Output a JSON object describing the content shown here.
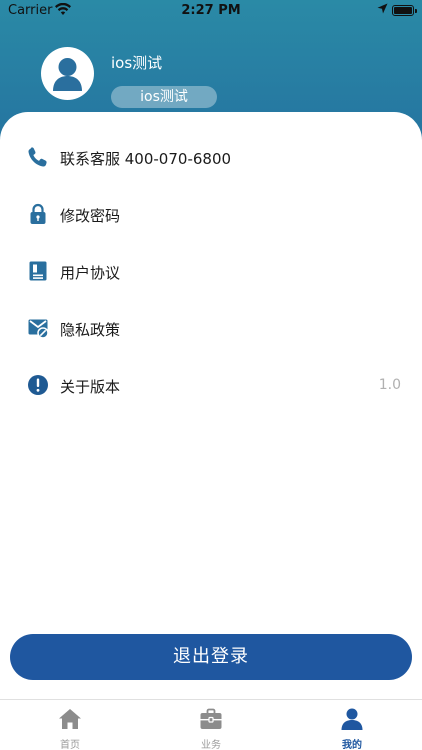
{
  "status_bar": {
    "carrier": "Carrier",
    "time": "2:27 PM",
    "battery_level": 1.0
  },
  "profile": {
    "name": "ios测试",
    "tag": "ios测试"
  },
  "menu": [
    {
      "label": "联系客服 400-070-6800",
      "icon": "phone-icon",
      "value": ""
    },
    {
      "label": "修改密码",
      "icon": "lock-icon",
      "value": ""
    },
    {
      "label": "用户协议",
      "icon": "document-icon",
      "value": ""
    },
    {
      "label": "隐私政策",
      "icon": "privacy-icon",
      "value": ""
    },
    {
      "label": "关于版本",
      "icon": "info-icon",
      "value": "1.0"
    }
  ],
  "logout_label": "退出登录",
  "tabs": [
    {
      "label": "首页",
      "icon": "home-icon",
      "active": false
    },
    {
      "label": "业务",
      "icon": "briefcase-icon",
      "active": false
    },
    {
      "label": "我的",
      "icon": "person-icon",
      "active": true
    }
  ],
  "colors": {
    "header_gradient_top": "#2a8aa6",
    "header_gradient_bottom": "#2573a0",
    "accent": "#1f57a0",
    "icon_blue": "#2a6f9e",
    "inactive_gray": "#8c8c8c"
  }
}
